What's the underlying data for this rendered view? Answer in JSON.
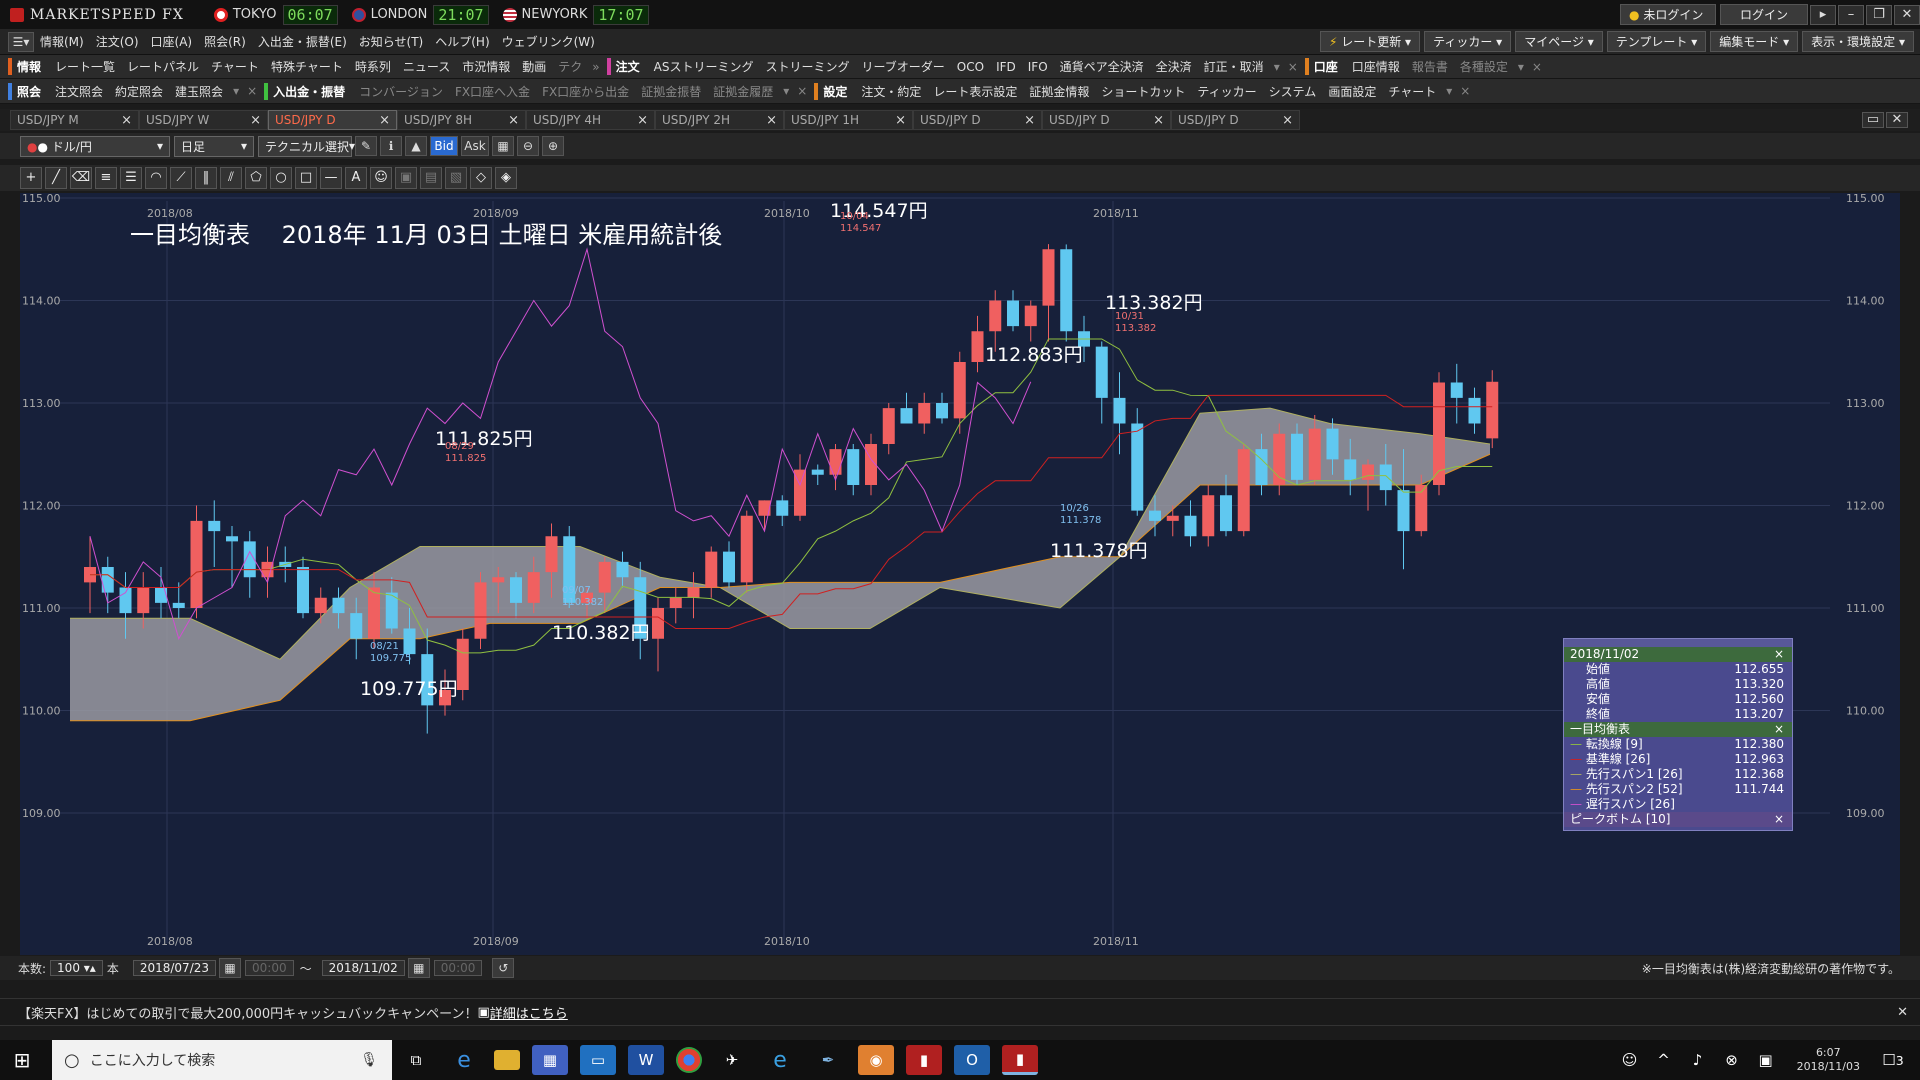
{
  "titlebar": {
    "app_name": "MARKETSPEED FX",
    "markets": [
      {
        "name": "TOKYO",
        "time": "06:07",
        "flag": "#e02020"
      },
      {
        "name": "LONDON",
        "time": "21:07",
        "flag": "#3050a0"
      },
      {
        "name": "NEWYORK",
        "time": "17:07",
        "flag": "#c03040"
      }
    ],
    "login_status": "未ログイン",
    "login_button": "ログイン"
  },
  "menubar": [
    "情報(M)",
    "注文(O)",
    "口座(A)",
    "照会(R)",
    "入出金・振替(E)",
    "お知らせ(T)",
    "ヘルプ(H)",
    "ウェブリンク(W)"
  ],
  "toolbar_right": [
    "レート更新",
    "ティッカー",
    "マイページ",
    "テンプレート",
    "編集モード",
    "表示・環境設定"
  ],
  "toolbar1": {
    "info_head": "情報",
    "info_items": [
      "レート一覧",
      "レートパネル",
      "チャート",
      "特殊チャート",
      "時系列",
      "ニュース",
      "市況情報",
      "動画",
      "テク"
    ],
    "order_head": "注文",
    "order_items": [
      "ASストリーミング",
      "ストリーミング",
      "リーブオーダー",
      "OCO",
      "IFD",
      "IFO",
      "通貨ペア全決済",
      "全決済",
      "訂正・取消"
    ],
    "account_head": "口座",
    "account_items": [
      "口座情報",
      "報告書",
      "各種設定"
    ]
  },
  "toolbar2": {
    "inquiry_head": "照会",
    "inquiry_items": [
      "注文照会",
      "約定照会",
      "建玉照会"
    ],
    "deposit_head": "入出金・振替",
    "deposit_items": [
      "コンバージョン",
      "FX口座へ入金",
      "FX口座から出金",
      "証拠金振替",
      "証拠金履歴"
    ],
    "settings_head": "設定",
    "settings_items": [
      "注文・約定",
      "レート表示設定",
      "証拠金情報",
      "ショートカット",
      "ティッカー",
      "システム",
      "画面設定",
      "チャート"
    ]
  },
  "tabs": [
    {
      "label": "USD/JPY M",
      "active": false
    },
    {
      "label": "USD/JPY W",
      "active": false
    },
    {
      "label": "USD/JPY D",
      "active": true
    },
    {
      "label": "USD/JPY 8H",
      "active": false
    },
    {
      "label": "USD/JPY 4H",
      "active": false
    },
    {
      "label": "USD/JPY 2H",
      "active": false
    },
    {
      "label": "USD/JPY 1H",
      "active": false
    },
    {
      "label": "USD/JPY D",
      "active": false
    },
    {
      "label": "USD/JPY D",
      "active": false
    },
    {
      "label": "USD/JPY D",
      "active": false
    }
  ],
  "controls": {
    "pair": "ドル/円",
    "period": "日足",
    "technical": "テクニカル選択",
    "bid": "Bid",
    "ask": "Ask"
  },
  "chart_data": {
    "type": "candlestick",
    "title": "一目均衡表　 2018年 11月 03日 土曜日 米雇用統計後",
    "ylim": [
      108.8,
      115.4
    ],
    "yticks": [
      109.0,
      110.0,
      111.0,
      112.0,
      113.0,
      114.0,
      115.0
    ],
    "x_labels_top": [
      "2018/08",
      "2018/09",
      "2018/10",
      "2018/11"
    ],
    "x_labels_bottom": [
      "2018/08",
      "2018/09",
      "2018/10",
      "2018/11"
    ],
    "candles": [
      [
        111.25,
        111.7,
        110.95,
        111.4
      ],
      [
        111.4,
        111.5,
        110.95,
        111.15
      ],
      [
        111.2,
        111.35,
        110.7,
        110.95
      ],
      [
        110.95,
        111.35,
        110.8,
        111.2
      ],
      [
        111.2,
        111.4,
        110.9,
        111.05
      ],
      [
        111.05,
        111.25,
        110.9,
        111.0
      ],
      [
        111.0,
        112.0,
        110.9,
        111.85
      ],
      [
        111.85,
        112.05,
        111.4,
        111.75
      ],
      [
        111.7,
        111.8,
        111.2,
        111.65
      ],
      [
        111.65,
        111.75,
        111.1,
        111.3
      ],
      [
        111.3,
        111.6,
        111.1,
        111.45
      ],
      [
        111.45,
        111.6,
        111.25,
        111.4
      ],
      [
        111.4,
        111.5,
        110.9,
        110.95
      ],
      [
        110.95,
        111.2,
        110.85,
        111.1
      ],
      [
        111.1,
        111.2,
        110.8,
        110.95
      ],
      [
        110.95,
        111.1,
        110.5,
        110.7
      ],
      [
        110.7,
        111.35,
        110.6,
        111.2
      ],
      [
        111.15,
        111.3,
        110.75,
        110.8
      ],
      [
        110.8,
        111.0,
        110.45,
        110.55
      ],
      [
        110.55,
        110.8,
        109.775,
        110.05
      ],
      [
        110.05,
        110.4,
        109.95,
        110.2
      ],
      [
        110.2,
        110.8,
        110.1,
        110.7
      ],
      [
        110.7,
        111.35,
        110.6,
        111.25
      ],
      [
        111.25,
        111.4,
        110.95,
        111.3
      ],
      [
        111.3,
        111.35,
        110.9,
        111.05
      ],
      [
        111.05,
        111.5,
        110.95,
        111.35
      ],
      [
        111.35,
        111.825,
        111.1,
        111.7
      ],
      [
        111.7,
        111.8,
        111.0,
        111.05
      ],
      [
        111.05,
        111.2,
        110.9,
        111.15
      ],
      [
        111.15,
        111.5,
        110.95,
        111.45
      ],
      [
        111.45,
        111.55,
        111.2,
        111.3
      ],
      [
        111.3,
        111.45,
        110.5,
        110.7
      ],
      [
        110.7,
        111.1,
        110.382,
        111.0
      ],
      [
        111.0,
        111.2,
        110.85,
        111.1
      ],
      [
        111.1,
        111.35,
        110.9,
        111.2
      ],
      [
        111.2,
        111.6,
        111.1,
        111.55
      ],
      [
        111.55,
        111.65,
        111.2,
        111.25
      ],
      [
        111.25,
        111.95,
        111.15,
        111.9
      ],
      [
        111.9,
        112.05,
        111.75,
        112.05
      ],
      [
        112.05,
        112.1,
        111.8,
        111.9
      ],
      [
        111.9,
        112.5,
        111.85,
        112.35
      ],
      [
        112.35,
        112.4,
        112.2,
        112.3
      ],
      [
        112.3,
        112.6,
        112.15,
        112.55
      ],
      [
        112.55,
        112.6,
        112.1,
        112.2
      ],
      [
        112.2,
        112.7,
        112.1,
        112.6
      ],
      [
        112.6,
        113.0,
        112.5,
        112.95
      ],
      [
        112.95,
        113.1,
        112.8,
        112.8
      ],
      [
        112.8,
        113.1,
        112.7,
        113.0
      ],
      [
        113.0,
        113.1,
        112.8,
        112.85
      ],
      [
        112.85,
        113.5,
        112.7,
        113.4
      ],
      [
        113.4,
        113.85,
        113.3,
        113.7
      ],
      [
        113.7,
        114.1,
        113.5,
        114.0
      ],
      [
        114.0,
        114.1,
        113.7,
        113.75
      ],
      [
        113.75,
        114.0,
        113.6,
        113.95
      ],
      [
        113.95,
        114.55,
        113.6,
        114.5
      ],
      [
        114.5,
        114.547,
        113.6,
        113.7
      ],
      [
        113.7,
        113.85,
        113.4,
        113.55
      ],
      [
        113.55,
        113.6,
        112.8,
        113.05
      ],
      [
        113.05,
        113.3,
        112.5,
        112.8
      ],
      [
        112.8,
        112.95,
        111.9,
        111.95
      ],
      [
        111.95,
        112.1,
        111.7,
        111.85
      ],
      [
        111.85,
        112.0,
        111.7,
        111.9
      ],
      [
        111.9,
        112.05,
        111.6,
        111.7
      ],
      [
        111.7,
        112.2,
        111.6,
        112.1
      ],
      [
        112.1,
        112.3,
        111.7,
        111.75
      ],
      [
        111.75,
        112.6,
        111.7,
        112.55
      ],
      [
        112.55,
        112.7,
        112.1,
        112.2
      ],
      [
        112.2,
        112.8,
        112.1,
        112.7
      ],
      [
        112.7,
        112.8,
        112.2,
        112.25
      ],
      [
        112.25,
        112.883,
        112.2,
        112.75
      ],
      [
        112.75,
        112.85,
        112.3,
        112.45
      ],
      [
        112.45,
        112.65,
        112.1,
        112.25
      ],
      [
        112.25,
        112.45,
        111.95,
        112.4
      ],
      [
        112.4,
        112.6,
        112.0,
        112.15
      ],
      [
        112.15,
        112.55,
        111.378,
        111.75
      ],
      [
        111.75,
        112.3,
        111.7,
        112.2
      ],
      [
        112.2,
        113.3,
        112.1,
        113.2
      ],
      [
        113.2,
        113.382,
        112.8,
        113.05
      ],
      [
        113.05,
        113.15,
        112.7,
        112.8
      ],
      [
        112.655,
        113.32,
        112.56,
        113.207
      ]
    ],
    "annotations": [
      {
        "label": "114.547円",
        "date": "10/04",
        "price": "114.547",
        "type": "high"
      },
      {
        "label": "113.382円",
        "date": "10/31",
        "price": "113.382",
        "type": "high"
      },
      {
        "label": "112.883円",
        "type": "high"
      },
      {
        "label": "111.825円",
        "date": "08/29",
        "price": "111.825",
        "type": "high"
      },
      {
        "label": "111.378円",
        "date": "10/26",
        "price": "111.378",
        "type": "low"
      },
      {
        "label": "110.382円",
        "date": "09/07",
        "price": "110.382",
        "type": "low"
      },
      {
        "label": "109.775円",
        "date": "08/21",
        "price": "109.775",
        "type": "low"
      }
    ],
    "series": [
      {
        "name": "転換線 [9]",
        "color": "#90c040"
      },
      {
        "name": "基準線 [26]",
        "color": "#d02020"
      },
      {
        "name": "先行スパン1 [26]",
        "color": "#b0b060"
      },
      {
        "name": "先行スパン2 [52]",
        "color": "#e09020"
      },
      {
        "name": "遅行スパン [26]",
        "color": "#d050d0"
      }
    ],
    "up_color": "#f06060",
    "down_color": "#60c8f0",
    "background": "#17203a"
  },
  "info_panel": {
    "date": "2018/11/02",
    "ohlc": [
      {
        "label": "始値",
        "value": "112.655"
      },
      {
        "label": "高値",
        "value": "113.320"
      },
      {
        "label": "安値",
        "value": "112.560"
      },
      {
        "label": "終値",
        "value": "113.207"
      }
    ],
    "ichimoku_title": "一目均衡表",
    "ichimoku": [
      {
        "label": "転換線 [9]",
        "value": "112.380"
      },
      {
        "label": "基準線 [26]",
        "value": "112.963"
      },
      {
        "label": "先行スパン1 [26]",
        "value": "112.368"
      },
      {
        "label": "先行スパン2 [52]",
        "value": "111.744"
      },
      {
        "label": "遅行スパン [26]",
        "value": ""
      }
    ],
    "peak_title": "ピークボトム [10]"
  },
  "bottombar": {
    "count_label": "本数:",
    "count_value": "100",
    "count_unit": "本",
    "from_date": "2018/07/23",
    "from_time": "00:00",
    "to_date": "2018/11/02",
    "to_time": "00:00",
    "copyright": "※一目均衡表は(株)経済変動総研の著作物です。"
  },
  "news": {
    "text": "【楽天FX】はじめての取引で最大200,000円キャッシュバックキャンペーン！",
    "link": "詳細はこちら"
  },
  "taskbar": {
    "search_placeholder": "ここに入力して検索",
    "time": "6:07",
    "date": "2018/11/03",
    "notifications": "3"
  }
}
